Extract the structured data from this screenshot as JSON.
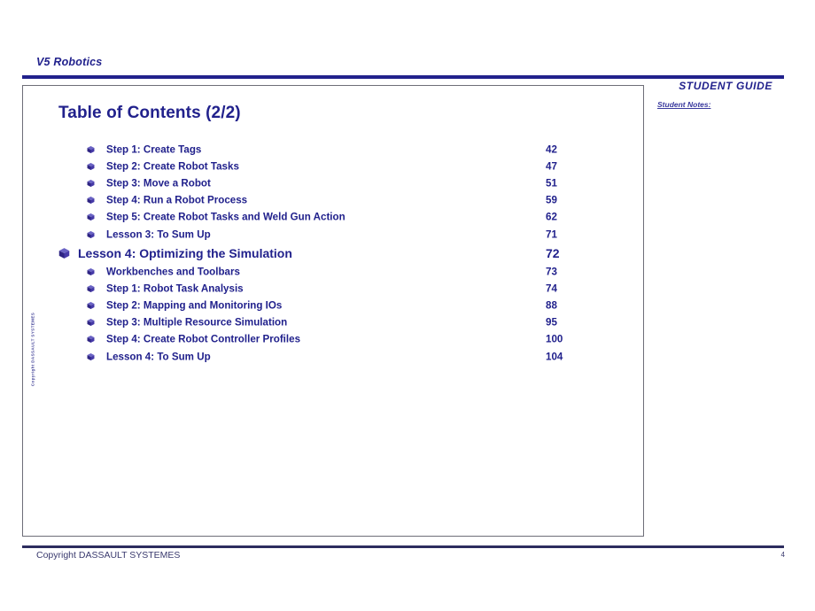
{
  "header": {
    "title": "V5 Robotics"
  },
  "sidebar_right": {
    "student_guide": "STUDENT GUIDE",
    "student_notes": "Student Notes:"
  },
  "content": {
    "title": "Table of Contents (2/2)",
    "entries": [
      {
        "level": 2,
        "bullet": "cube-bullet-icon",
        "label": "Step 1: Create Tags",
        "page": "42"
      },
      {
        "level": 2,
        "bullet": "cube-bullet-icon",
        "label": "Step 2: Create Robot Tasks",
        "page": "47"
      },
      {
        "level": 2,
        "bullet": "cube-bullet-icon",
        "label": "Step 3: Move a Robot",
        "page": "51"
      },
      {
        "level": 2,
        "bullet": "cube-bullet-icon",
        "label": "Step 4: Run a Robot Process",
        "page": "59"
      },
      {
        "level": 2,
        "bullet": "cube-bullet-icon",
        "label": "Step 5: Create Robot Tasks and Weld Gun Action",
        "page": "62"
      },
      {
        "level": 2,
        "bullet": "cube-bullet-icon",
        "label": "Lesson 3: To Sum Up",
        "page": "71"
      },
      {
        "level": 1,
        "bullet": "cube-bullet-large-icon",
        "label": "Lesson 4: Optimizing the Simulation",
        "page": "72"
      },
      {
        "level": 2,
        "bullet": "cube-bullet-icon",
        "label": "Workbenches and Toolbars",
        "page": "73"
      },
      {
        "level": 2,
        "bullet": "cube-bullet-icon",
        "label": "Step 1: Robot Task Analysis",
        "page": "74"
      },
      {
        "level": 2,
        "bullet": "cube-bullet-icon",
        "label": "Step 2: Mapping and Monitoring IOs",
        "page": "88"
      },
      {
        "level": 2,
        "bullet": "cube-bullet-icon",
        "label": "Step 3: Multiple Resource Simulation",
        "page": "95"
      },
      {
        "level": 2,
        "bullet": "cube-bullet-icon",
        "label": "Step 4: Create Robot Controller Profiles",
        "page": "100"
      },
      {
        "level": 2,
        "bullet": "cube-bullet-icon",
        "label": "Lesson 4: To Sum Up",
        "page": "104"
      }
    ]
  },
  "vertical_copyright": "Copyright DASSAULT SYSTEMES",
  "footer": {
    "copyright": "Copyright DASSAULT SYSTEMES",
    "page_number": "4"
  },
  "colors": {
    "navy": "#21218c",
    "rule": "#2c2c5e",
    "bullet": "#3b2f9e",
    "box_border": "#6e6e78"
  }
}
